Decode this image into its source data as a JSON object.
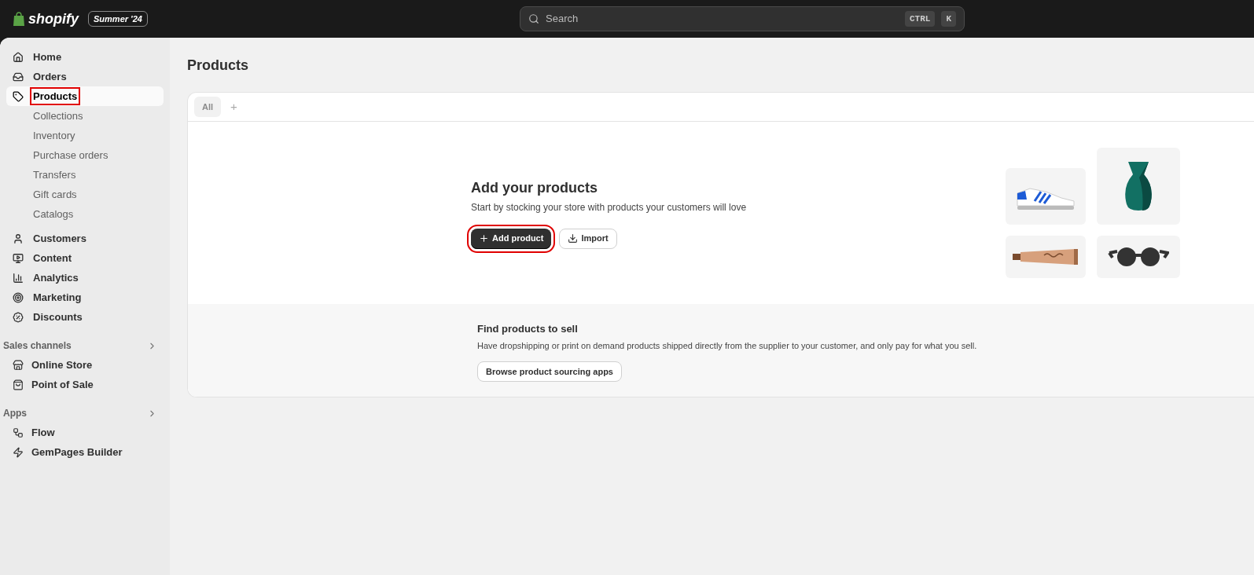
{
  "topbar": {
    "logo": "shopify",
    "edition": "Summer '24",
    "search": {
      "placeholder": "Search",
      "keys": [
        "CTRL",
        "K"
      ]
    }
  },
  "sidebar": {
    "items": [
      {
        "label": "Home",
        "selected": false,
        "highlighted": false
      },
      {
        "label": "Orders",
        "selected": false,
        "highlighted": false
      },
      {
        "label": "Products",
        "selected": true,
        "highlighted": true,
        "children": [
          {
            "label": "Collections"
          },
          {
            "label": "Inventory"
          },
          {
            "label": "Purchase orders"
          },
          {
            "label": "Transfers"
          },
          {
            "label": "Gift cards"
          },
          {
            "label": "Catalogs"
          }
        ]
      },
      {
        "label": "Customers",
        "selected": false,
        "highlighted": false
      },
      {
        "label": "Content",
        "selected": false,
        "highlighted": false
      },
      {
        "label": "Analytics",
        "selected": false,
        "highlighted": false
      },
      {
        "label": "Marketing",
        "selected": false,
        "highlighted": false
      },
      {
        "label": "Discounts",
        "selected": false,
        "highlighted": false
      }
    ],
    "sections": [
      {
        "title": "Sales channels",
        "items": [
          {
            "label": "Online Store"
          },
          {
            "label": "Point of Sale"
          }
        ]
      },
      {
        "title": "Apps",
        "items": [
          {
            "label": "Flow"
          },
          {
            "label": "GemPages Builder"
          }
        ]
      }
    ]
  },
  "page": {
    "title": "Products",
    "tabs": [
      {
        "label": "All",
        "selected": true
      }
    ],
    "add_tab": "+",
    "empty_state": {
      "title": "Add your products",
      "text": "Start by stocking your store with products your customers will love",
      "buttons": [
        {
          "label": "Add product",
          "kind": "primary",
          "highlighted": true
        },
        {
          "label": "Import",
          "kind": "secondary",
          "highlighted": false
        }
      ]
    },
    "sourcing": {
      "title": "Find products to sell",
      "text": "Have dropshipping or print on demand products shipped directly from the supplier to your customer, and only pay for what you sell.",
      "button": "Browse product sourcing apps"
    }
  }
}
